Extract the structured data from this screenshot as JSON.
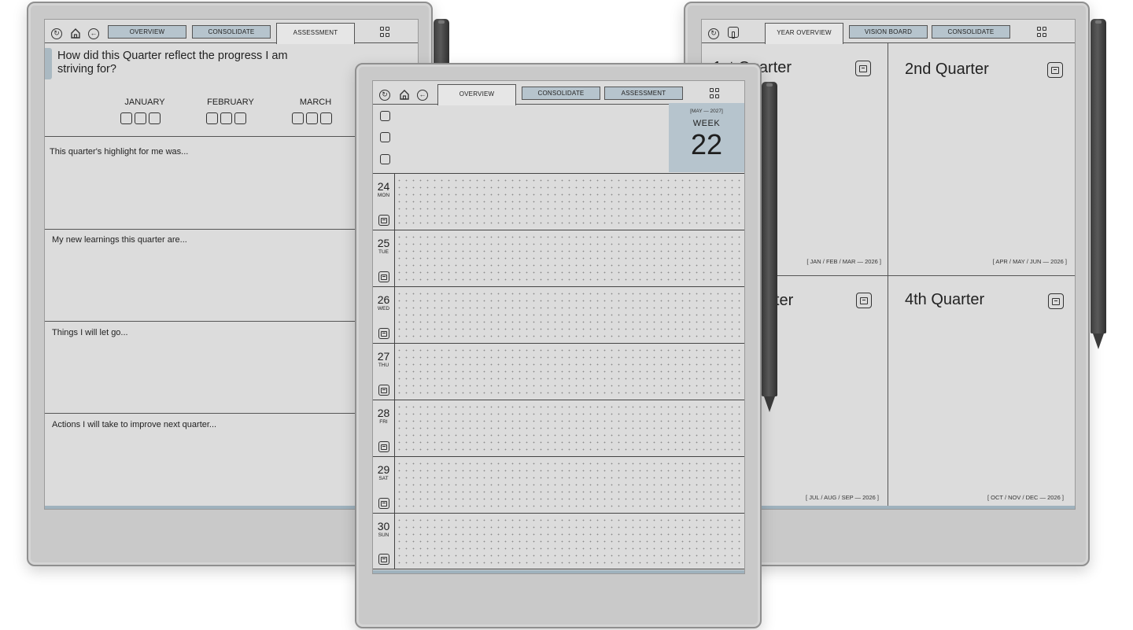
{
  "left_screen": {
    "tabs": [
      "OVERVIEW",
      "CONSOLIDATE",
      "ASSESSMENT"
    ],
    "question": "How did this Quarter reflect the progress I am striving for?",
    "months": [
      "JANUARY",
      "FEBRUARY",
      "MARCH"
    ],
    "prompts": [
      "This quarter's highlight for me was...",
      "My new learnings this quarter are...",
      "Things I will let go...",
      "Actions I will take to improve next quarter..."
    ]
  },
  "center_screen": {
    "tabs": [
      "OVERVIEW",
      "CONSOLIDATE",
      "ASSESSMENT"
    ],
    "week": {
      "range": "[MAY — 2027]",
      "label": "WEEK",
      "number": "22"
    },
    "days": [
      {
        "num": "24",
        "name": "MON"
      },
      {
        "num": "25",
        "name": "TUE"
      },
      {
        "num": "26",
        "name": "WED"
      },
      {
        "num": "27",
        "name": "THU"
      },
      {
        "num": "28",
        "name": "FRI"
      },
      {
        "num": "29",
        "name": "SAT"
      },
      {
        "num": "30",
        "name": "SUN"
      }
    ]
  },
  "right_screen": {
    "tabs": [
      "YEAR OVERVIEW",
      "VISION BOARD",
      "CONSOLIDATE"
    ],
    "quarters": [
      {
        "title": "1st Quarter",
        "range": "[ JAN / FEB / MAR — 2026 ]"
      },
      {
        "title": "2nd Quarter",
        "range": "[ APR / MAY / JUN — 2026 ]"
      },
      {
        "title": "3rd Quarter",
        "range": "[ JUL / AUG / SEP — 2026 ]"
      },
      {
        "title": "4th Quarter",
        "range": "[ OCT / NOV / DEC — 2026 ]"
      }
    ]
  }
}
